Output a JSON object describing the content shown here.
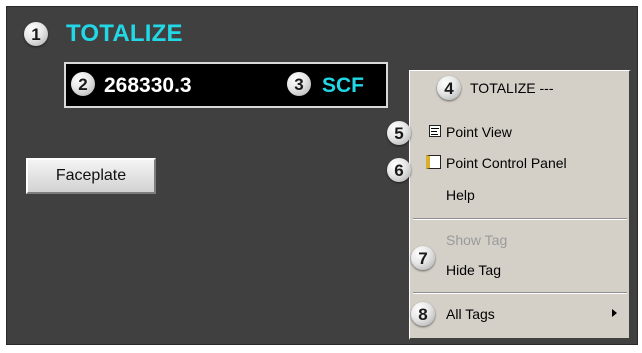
{
  "callouts": [
    "1",
    "2",
    "3",
    "4",
    "5",
    "6",
    "7",
    "8"
  ],
  "tag": {
    "title": "TOTALIZE",
    "value": "268330.3",
    "unit": "SCF"
  },
  "faceplate_button": "Faceplate",
  "context_menu": {
    "header": "TOTALIZE ---",
    "items": [
      {
        "label": "Point View",
        "enabled": true,
        "icon": "point-view-icon"
      },
      {
        "label": "Point Control Panel",
        "enabled": true,
        "icon": "control-panel-icon"
      },
      {
        "label": "Help",
        "enabled": true
      },
      {
        "label": "Show Tag",
        "enabled": false
      },
      {
        "label": "Hide Tag",
        "enabled": true
      },
      {
        "label": "All Tags",
        "enabled": true,
        "submenu": true
      }
    ]
  },
  "colors": {
    "background": "#404040",
    "accent_cyan": "#22d7e6",
    "menu_bg": "#d4d0c8"
  }
}
